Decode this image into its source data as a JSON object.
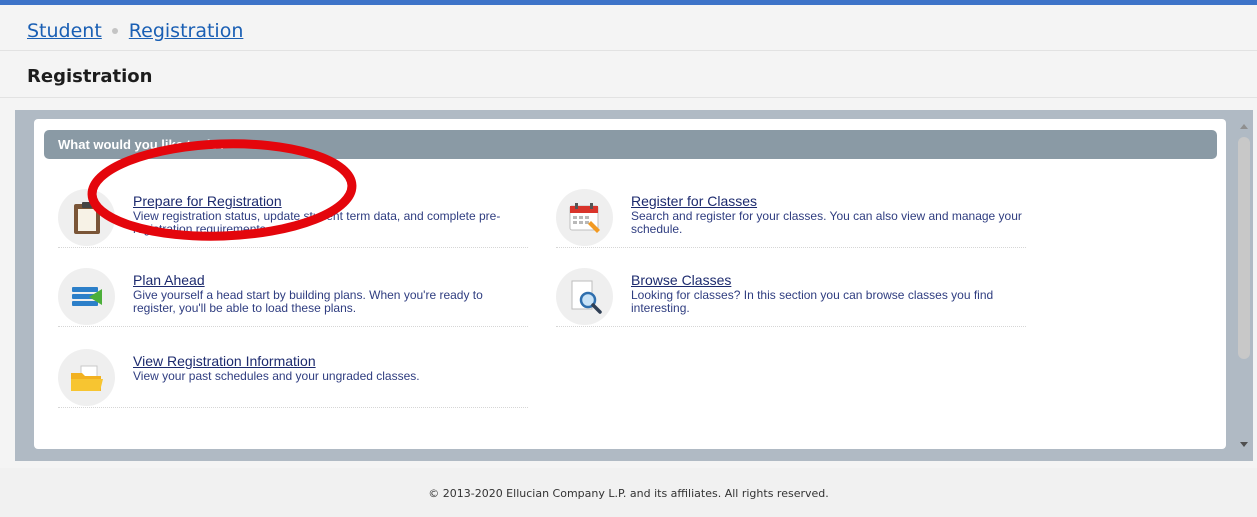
{
  "breadcrumb": {
    "items": [
      "Student",
      "Registration"
    ]
  },
  "page": {
    "title": "Registration"
  },
  "section": {
    "header": "What would you like to do?"
  },
  "tasks": [
    {
      "icon": "clipboard-icon",
      "title": "Prepare for Registration",
      "description": "View registration status, update student term data, and complete pre-registration requirements."
    },
    {
      "icon": "calendar-icon",
      "title": "Register for Classes",
      "description": "Search and register for your classes. You can also view and manage your schedule."
    },
    {
      "icon": "list-icon",
      "title": "Plan Ahead",
      "description": "Give yourself a head start by building plans. When you're ready to register, you'll be able to load these plans."
    },
    {
      "icon": "magnifier-document-icon",
      "title": "Browse Classes",
      "description": "Looking for classes? In this section you can browse classes you find interesting."
    },
    {
      "icon": "folder-icon",
      "title": "View Registration Information",
      "description": "View your past schedules and your ungraded classes."
    }
  ],
  "footer": {
    "text": "© 2013-2020 Ellucian Company L.P. and its affiliates. All rights reserved."
  },
  "colors": {
    "accent": "#3d73c8",
    "link": "#1a5fb4",
    "section_header": "#8a9aa5",
    "annotation": "#e4060c"
  }
}
